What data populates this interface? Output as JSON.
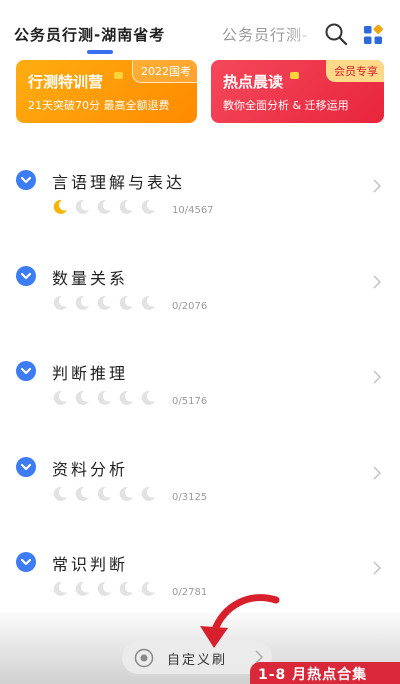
{
  "tabs": [
    {
      "label": "公务员行测-湖南省考"
    },
    {
      "label": "公务员行测-"
    }
  ],
  "banners": {
    "left": {
      "title": "行测特训营",
      "tag": "2022国考",
      "subtitle": "21天突破70分 最高全额退费"
    },
    "right": {
      "title": "热点晨读",
      "tag": "会员专享",
      "subtitle": "教你全面分析 & 迁移运用"
    }
  },
  "categories": [
    {
      "title": "言语理解与表达",
      "count": "10/4567",
      "lit_moons": 1
    },
    {
      "title": "数量关系",
      "count": "0/2076",
      "lit_moons": 0
    },
    {
      "title": "判断推理",
      "count": "0/5176",
      "lit_moons": 0
    },
    {
      "title": "资料分析",
      "count": "0/3125",
      "lit_moons": 0
    },
    {
      "title": "常识判断",
      "count": "0/2781",
      "lit_moons": 0
    }
  ],
  "bottom": {
    "custom_label": "自定义刷",
    "hot_label": "1-8 月热点合集"
  },
  "colors": {
    "accent": "#3a6df0",
    "orange": "#ff9c0a",
    "red": "#e8253d",
    "moon_lit": "#f7b500",
    "moon_dim": "#e2e2e2"
  },
  "icons": [
    "search-icon",
    "grid-icon",
    "chevron-down-icon",
    "chevron-right-icon",
    "moon-icon",
    "gear-icon"
  ]
}
